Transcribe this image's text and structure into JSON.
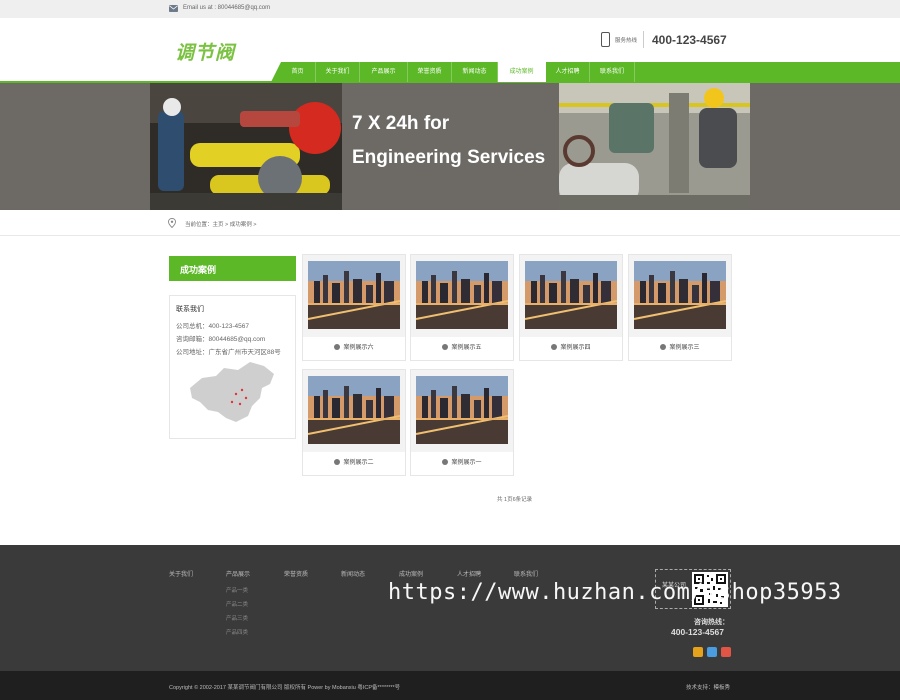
{
  "topbar": {
    "email": "Email us at : 80044685@qq.com"
  },
  "header": {
    "logo_text": "调节阀",
    "hotline_label": "服务热线",
    "hotline_number": "400-123-4567"
  },
  "nav": {
    "items": [
      {
        "label": "首页",
        "active": false
      },
      {
        "label": "关于我们",
        "active": false
      },
      {
        "label": "产品展示",
        "active": false
      },
      {
        "label": "荣誉资质",
        "active": false
      },
      {
        "label": "新闻动态",
        "active": false
      },
      {
        "label": "成功案例",
        "active": true
      },
      {
        "label": "人才招聘",
        "active": false
      },
      {
        "label": "联系我们",
        "active": false
      }
    ]
  },
  "banner": {
    "line1": "7 X 24h for",
    "line2": "Engineering Services"
  },
  "breadcrumb": {
    "text": "当前位置：主页 > 成功案例 >"
  },
  "sidebar": {
    "title": "成功案例",
    "contact_title": "联系我们",
    "phone": "公司总机：400-123-4567",
    "email": "咨询邮箱：80044685@qq.com",
    "address": "公司地址：广东省广州市天河区88号"
  },
  "cases": [
    {
      "label": "案例展示六"
    },
    {
      "label": "案例展示五"
    },
    {
      "label": "案例展示四"
    },
    {
      "label": "案例展示三"
    },
    {
      "label": "案例展示二"
    },
    {
      "label": "案例展示一"
    }
  ],
  "pager": {
    "text": "共 1页6条记录"
  },
  "footer": {
    "columns": [
      {
        "label": "关于我们"
      },
      {
        "label": "产品展示",
        "items": [
          "产品一类",
          "产品二类",
          "产品三类",
          "产品四类"
        ]
      },
      {
        "label": "荣誉资质"
      },
      {
        "label": "新闻动态"
      },
      {
        "label": "成功案例"
      },
      {
        "label": "人才招聘"
      },
      {
        "label": "联系我们"
      }
    ],
    "qr_company": "某某公司",
    "consult_label": "咨询热线：",
    "consult_number": "400-123-4567",
    "social_icons": [
      "weibo-icon",
      "qq-icon",
      "tencent-weibo-icon"
    ],
    "copyright": "Copyright © 2002-2017 某某调节阀门有限公司 版权所有 Power by Mobanxiu 粤ICP备********号",
    "support": "技术支持：模板秀"
  },
  "watermark": "https://www.huzhan.com/ishop35953",
  "colors": {
    "accent": "#5cb827",
    "footer": "#3a3a3a",
    "footer_bottom": "#1f1f1f"
  }
}
